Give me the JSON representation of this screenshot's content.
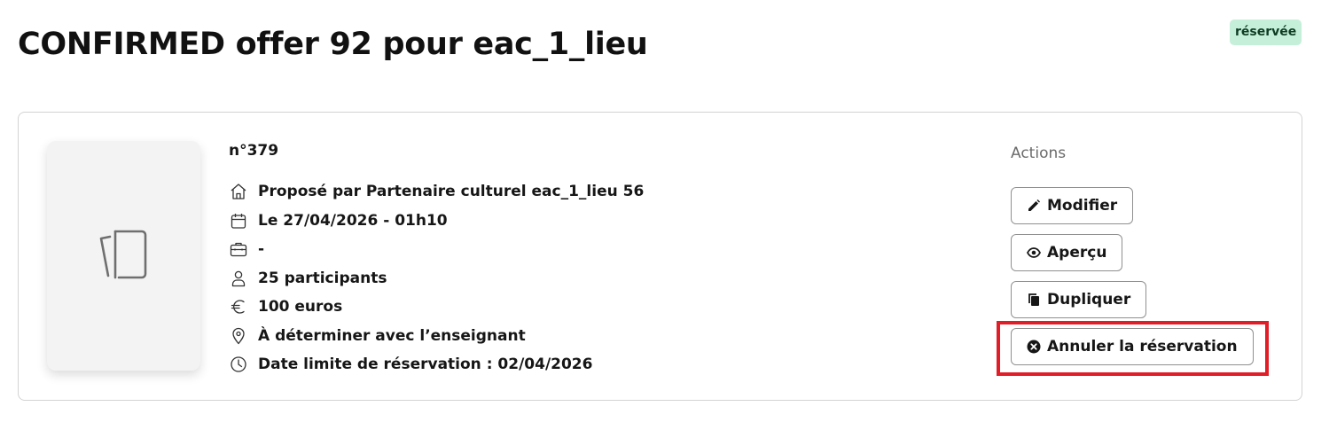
{
  "page": {
    "title": "CONFIRMED offer 92 pour eac_1_lieu",
    "status_badge": "réservée"
  },
  "offer": {
    "number": "n°379",
    "details": [
      {
        "icon": "house-icon",
        "text": "Proposé par Partenaire culturel eac_1_lieu 56"
      },
      {
        "icon": "calendar-icon",
        "text": "Le 27/04/2026 - 01h10"
      },
      {
        "icon": "briefcase-icon",
        "text": "-"
      },
      {
        "icon": "user-icon",
        "text": "25 participants"
      },
      {
        "icon": "euro-icon",
        "text": "100 euros"
      },
      {
        "icon": "location-pin-icon",
        "text": "À déterminer avec l’enseignant"
      },
      {
        "icon": "clock-icon",
        "text": "Date limite de réservation : 02/04/2026"
      }
    ],
    "thumbnail_icon": "image-placeholder-icon"
  },
  "actions": {
    "title": "Actions",
    "modify_label": "Modifier",
    "preview_label": "Aperçu",
    "duplicate_label": "Dupliquer",
    "cancel_booking_label": "Annuler la réservation"
  },
  "colors": {
    "badge_bg": "#c6efd9",
    "badge_text": "#0f3d24",
    "highlight": "#e11d28",
    "border": "#d3d3d3",
    "button_border": "#909090"
  }
}
